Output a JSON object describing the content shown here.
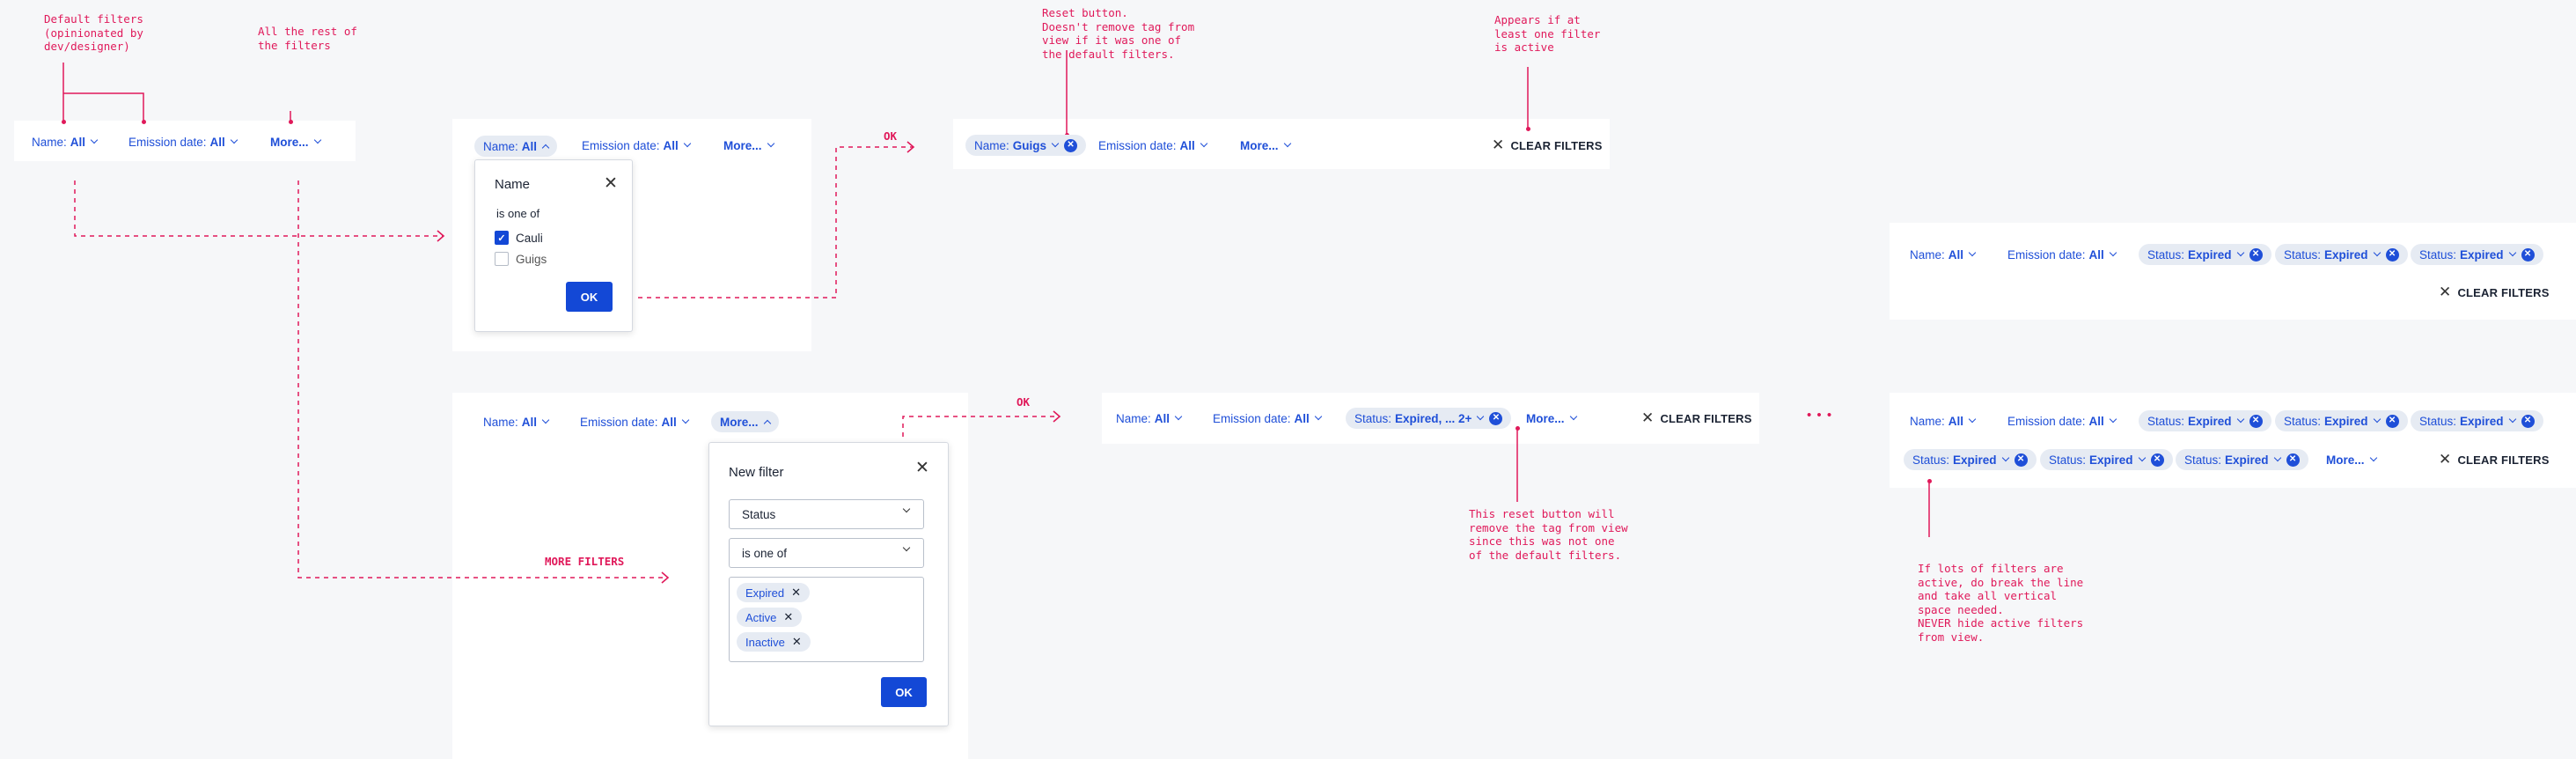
{
  "annotations": {
    "default_filters": "Default filters\n(opinionated by\ndev/designer)",
    "rest_filters": "All the rest of\nthe filters",
    "reset_button": "Reset button.\nDoesn't remove tag from\nview if it was one of\nthe default filters.",
    "appears_if": "Appears if at\nleast one filter\nis active",
    "reset_removes": "This reset button will\nremove the tag from view\nsince this was not one\nof the default filters.",
    "lots_filters": "If lots of filters are\nactive, do break the line\nand take all vertical\nspace needed.\nNEVER hide active filters\nfrom view."
  },
  "flow_labels": {
    "ok_top": "OK",
    "ok_bottom": "OK",
    "more_filters": "MORE FILTERS"
  },
  "filters": {
    "name_label": "Name:",
    "name_value_all": "All",
    "name_value_guigs": "Guigs",
    "emission_label": "Emission date:",
    "emission_value": "All",
    "more": "More...",
    "status_label": "Status:",
    "status_expired": "Expired",
    "status_combined": "Expired, ... 2+",
    "clear": "CLEAR FILTERS"
  },
  "name_popup": {
    "title": "Name",
    "operator": "is one of",
    "options": [
      {
        "label": "Cauli",
        "checked": true
      },
      {
        "label": "Guigs",
        "checked": false
      }
    ],
    "ok": "OK"
  },
  "new_filter_popup": {
    "title": "New filter",
    "field": "Status",
    "operator": "is one of",
    "values": [
      "Expired",
      "Active",
      "Inactive"
    ],
    "ok": "OK"
  },
  "ellipsis": "• • •",
  "colors": {
    "accent": "#1f4fd8",
    "annotation": "#e0195a",
    "button": "#1348d6"
  }
}
